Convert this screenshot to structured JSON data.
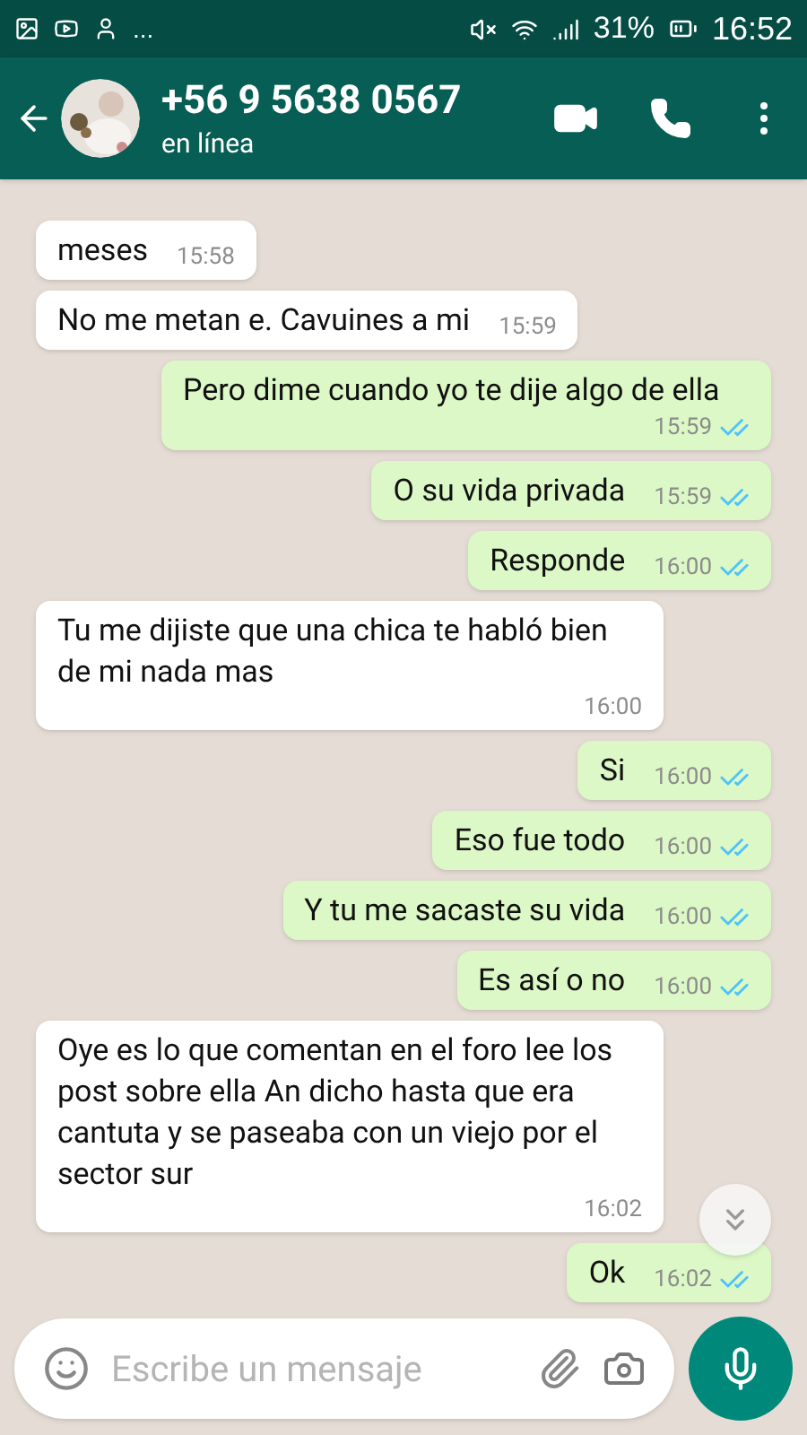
{
  "status_bar": {
    "battery": "31%",
    "time": "16:52",
    "more": "..."
  },
  "header": {
    "contact": "+56 9 5638 0567",
    "status": "en línea"
  },
  "messages": [
    {
      "kind": "incoming",
      "text": "meses",
      "time": "15:58"
    },
    {
      "kind": "incoming",
      "text": "No me metan e. Cavuines a mi",
      "time": "15:59"
    },
    {
      "kind": "outgoing",
      "text": "Pero dime cuando yo te dije algo de ella",
      "time": "15:59",
      "read": true
    },
    {
      "kind": "outgoing",
      "text": "O su vida privada",
      "time": "15:59",
      "read": true
    },
    {
      "kind": "outgoing",
      "text": "Responde",
      "time": "16:00",
      "read": true
    },
    {
      "kind": "incoming",
      "text": "Tu me dijiste que una chica te habló bien de mi nada mas",
      "time": "16:00"
    },
    {
      "kind": "outgoing",
      "text": "Si",
      "time": "16:00",
      "read": true
    },
    {
      "kind": "outgoing",
      "text": "Eso fue todo",
      "time": "16:00",
      "read": true
    },
    {
      "kind": "outgoing",
      "text": "Y tu me sacaste su vida",
      "time": "16:00",
      "read": true
    },
    {
      "kind": "outgoing",
      "text": "Es así o no",
      "time": "16:00",
      "read": true
    },
    {
      "kind": "incoming",
      "text": "Oye es lo que comentan en el foro lee los post sobre ella An dicho hasta que era cantuta y se paseaba con un viejo por el sector sur",
      "time": "16:02"
    },
    {
      "kind": "outgoing",
      "text": "Ok",
      "time": "16:02",
      "read": true
    }
  ],
  "composer": {
    "placeholder": "Escribe un mensaje"
  }
}
